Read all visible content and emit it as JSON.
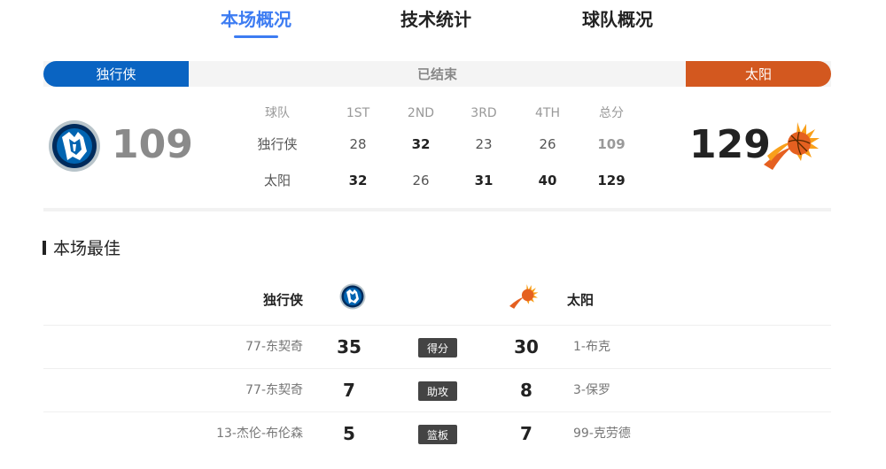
{
  "tabs": [
    {
      "label": "本场概况",
      "active": true
    },
    {
      "label": "技术统计",
      "active": false
    },
    {
      "label": "球队概况",
      "active": false
    }
  ],
  "status": {
    "home_team": "独行侠",
    "away_team": "太阳",
    "game_state": "已结束",
    "home_color": "#0a64c2",
    "away_color": "#d3581f"
  },
  "score": {
    "home": "109",
    "away": "129",
    "home_logo": "mavericks-logo",
    "away_logo": "suns-logo"
  },
  "box_score": {
    "headers": [
      "球队",
      "1ST",
      "2ND",
      "3RD",
      "4TH",
      "总分"
    ],
    "rows": [
      {
        "team": "独行侠",
        "q": [
          "28",
          "32",
          "23",
          "26"
        ],
        "total": "109",
        "bold": [
          false,
          true,
          false,
          false,
          false
        ]
      },
      {
        "team": "太阳",
        "q": [
          "32",
          "26",
          "31",
          "40"
        ],
        "total": "129",
        "bold": [
          true,
          false,
          true,
          true,
          true
        ]
      }
    ]
  },
  "best": {
    "title": "本场最佳",
    "home_team": "独行侠",
    "away_team": "太阳",
    "rows": [
      {
        "home_player": "77-东契奇",
        "home_value": "35",
        "stat": "得分",
        "away_value": "30",
        "away_player": "1-布克"
      },
      {
        "home_player": "77-东契奇",
        "home_value": "7",
        "stat": "助攻",
        "away_value": "8",
        "away_player": "3-保罗"
      },
      {
        "home_player": "13-杰伦-布伦森",
        "home_value": "5",
        "stat": "篮板",
        "away_value": "7",
        "away_player": "99-克劳德"
      }
    ]
  }
}
